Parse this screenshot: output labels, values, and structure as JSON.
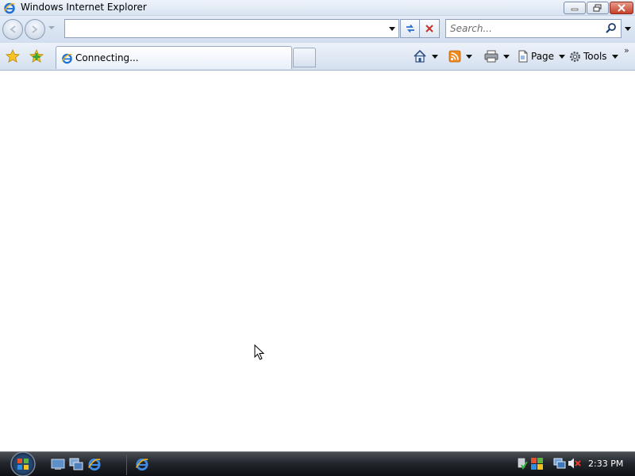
{
  "window": {
    "title": "Windows Internet Explorer"
  },
  "address_bar": {
    "value": "",
    "placeholder": ""
  },
  "search": {
    "placeholder": "Search..."
  },
  "tab": {
    "label": "Connecting..."
  },
  "command_bar": {
    "page_label": "Page",
    "tools_label": "Tools"
  },
  "taskbar": {
    "clock": "2:33 PM"
  },
  "icons": {
    "ie": "internet-explorer-icon",
    "back": "back-arrow-icon",
    "forward": "forward-arrow-icon",
    "refresh": "refresh-icon",
    "stop": "stop-x-icon",
    "search": "magnifier-icon",
    "favorites": "star-icon",
    "add_favorites": "add-favorite-icon",
    "home": "home-icon",
    "feeds": "rss-feed-icon",
    "print": "printer-icon",
    "page": "page-icon",
    "tools": "gear-icon"
  },
  "colors": {
    "taskbar": "#23272d",
    "chrome": "#d9e4f2",
    "close_button": "#c6402a"
  }
}
